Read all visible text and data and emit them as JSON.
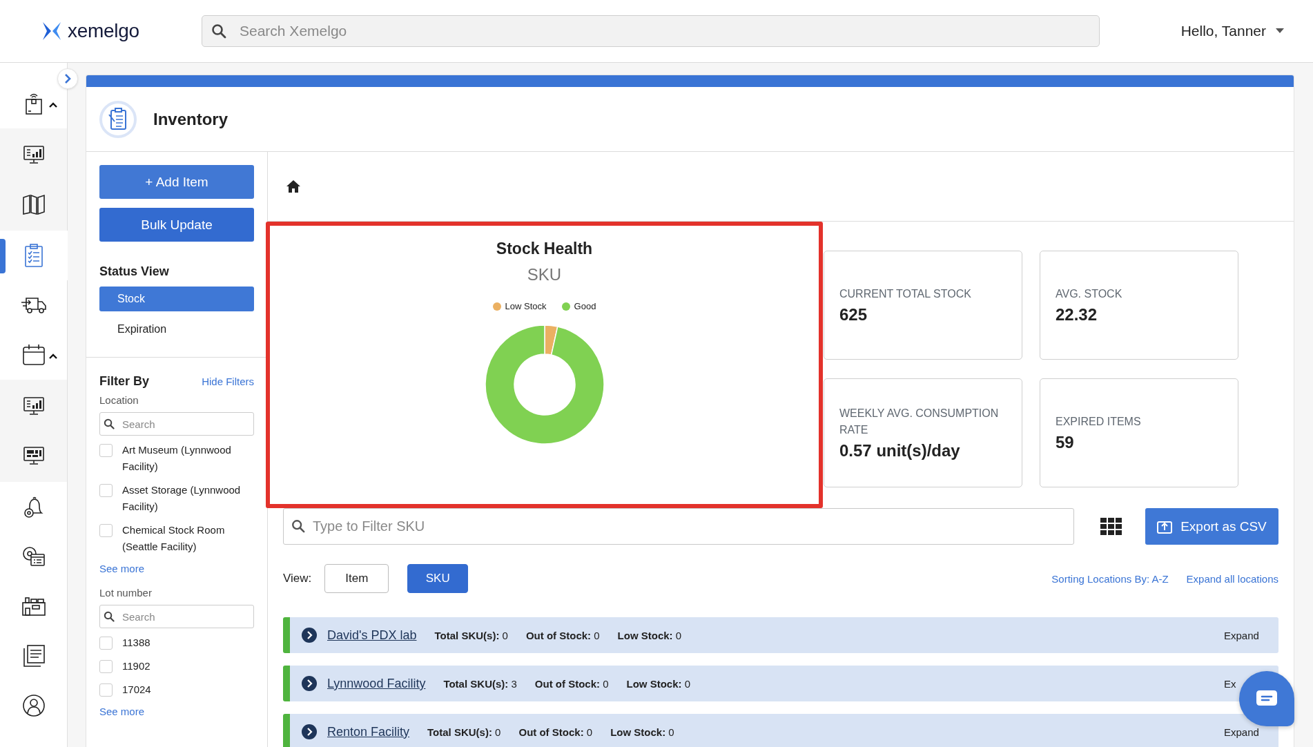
{
  "header": {
    "logo": "xemelgo",
    "search": {
      "placeholder": "Search Xemelgo"
    },
    "user": "Hello, Tanner"
  },
  "nav": [
    {
      "selected": false,
      "expanded": true,
      "children": [
        {
          "selected": false
        },
        {
          "selected": false
        }
      ]
    },
    {
      "selected": true
    },
    {
      "selected": false
    },
    {
      "selected": false,
      "expanded": true,
      "children": [
        {
          "selected": false
        },
        {
          "selected": false
        }
      ]
    },
    {
      "selected": false
    },
    {
      "selected": false
    },
    {
      "selected": false
    },
    {
      "selected": false
    },
    {
      "selected": false
    }
  ],
  "page": {
    "title": "Inventory",
    "actions": [
      "+ Add Item",
      "Bulk Update"
    ],
    "status_view": {
      "title": "Status View",
      "options": [
        {
          "label": "Stock",
          "selected": true
        },
        {
          "label": "Expiration",
          "selected": false
        }
      ]
    },
    "filters": {
      "title": "Filter By",
      "hide": "Hide Filters",
      "groups": [
        {
          "label": "Location",
          "placeholder": "Search",
          "see_more": "See more",
          "options": [
            {
              "label": "Art Museum (Lynnwood Facility)",
              "checked": false
            },
            {
              "label": "Asset Storage (Lynnwood Facility)",
              "checked": false
            },
            {
              "label": "Chemical Stock Room (Seattle Facility)",
              "checked": false
            }
          ]
        },
        {
          "label": "Lot number",
          "placeholder": "Search",
          "see_more": "See more",
          "options": [
            {
              "label": "11388",
              "checked": false
            },
            {
              "label": "11902",
              "checked": false
            },
            {
              "label": "17024",
              "checked": false
            }
          ]
        }
      ]
    }
  },
  "chart": {
    "title": "Stock Health",
    "subtitle": "SKU",
    "highlighted": true,
    "legend": [
      {
        "label": "Low Stock",
        "color": "#ebb062"
      },
      {
        "label": "Good",
        "color": "#80d152"
      }
    ]
  },
  "metrics": [
    {
      "label": "CURRENT TOTAL STOCK",
      "value": "625"
    },
    {
      "label": "AVG. STOCK",
      "value": "22.32"
    },
    {
      "label": "WEEKLY AVG. CONSUMPTION RATE",
      "value": "0.57 unit(s)/day"
    },
    {
      "label": "EXPIRED ITEMS",
      "value": "59"
    }
  ],
  "table_tools": {
    "filter_placeholder": "Type to Filter SKU",
    "export": "Export as CSV",
    "view_label": "View:",
    "views": [
      {
        "label": "Item",
        "selected": false
      },
      {
        "label": "SKU",
        "selected": true
      }
    ],
    "sort": "Sorting Locations By: A-Z",
    "expand_all": "Expand all locations"
  },
  "locations": [
    {
      "name": "David's PDX lab",
      "stats": [
        {
          "label": "Total SKU(s):",
          "value": "0"
        },
        {
          "label": "Out of Stock:",
          "value": "0"
        },
        {
          "label": "Low Stock:",
          "value": "0"
        }
      ],
      "action": "Expand"
    },
    {
      "name": "Lynnwood Facility",
      "stats": [
        {
          "label": "Total SKU(s):",
          "value": "3"
        },
        {
          "label": "Out of Stock:",
          "value": "0"
        },
        {
          "label": "Low Stock:",
          "value": "0"
        }
      ],
      "action": "Ex"
    },
    {
      "name": "Renton Facility",
      "stats": [
        {
          "label": "Total SKU(s):",
          "value": "0"
        },
        {
          "label": "Out of Stock:",
          "value": "0"
        },
        {
          "label": "Low Stock:",
          "value": "0"
        }
      ],
      "action": "Expand"
    }
  ]
}
